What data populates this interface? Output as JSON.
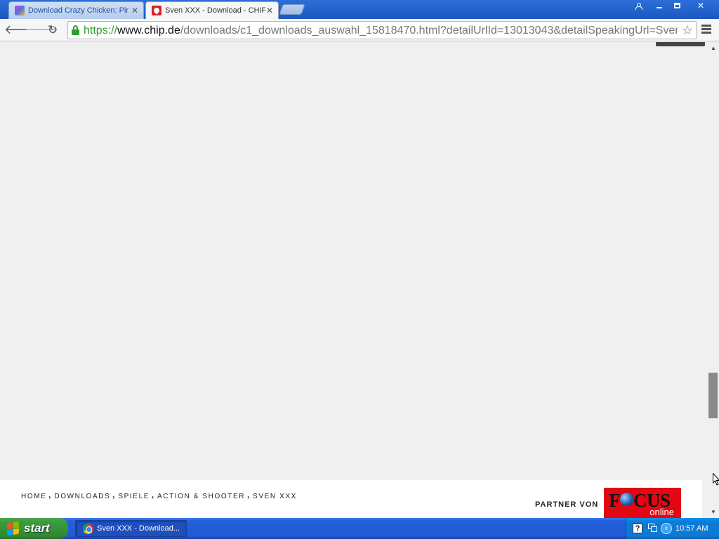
{
  "browser": {
    "tabs": [
      {
        "title": "Download Crazy Chicken: Pir",
        "active": false,
        "favicon": "crazy-chicken-favicon"
      },
      {
        "title": "Sven XXX - Download - CHIP",
        "active": true,
        "favicon": "chip-favicon"
      }
    ],
    "close_glyph": "✕",
    "url": {
      "scheme": "https://",
      "host": "www.chip.de",
      "path": "/downloads/c1_downloads_auswahl_15818470.html?detailUrlId=13013043&detailSpeakingUrl=Sven"
    },
    "icons": {
      "back": "arrow-left-icon",
      "forward": "arrow-right-icon",
      "reload": "reload-icon",
      "lock": "lock-icon",
      "bookmark": "star-icon",
      "menu": "hamburger-menu-icon"
    },
    "glyphs": {
      "back": "🡐",
      "forward": "🡒",
      "reload": "↻",
      "star": "☆"
    }
  },
  "page": {
    "breadcrumb": [
      "HOME",
      "DOWNLOADS",
      "SPIELE",
      "ACTION & SHOOTER",
      "SVEN XXX"
    ],
    "partner_label": "PARTNER VON",
    "partner_logo": {
      "word_left": "F",
      "word_right": "CUS",
      "sub": "online"
    },
    "colors": {
      "background": "#f0f0f0",
      "footer": "#ffffff",
      "focus_red": "#e30613"
    },
    "scroll_position": 0.78
  },
  "taskbar": {
    "start_label": "start",
    "task_item": "Sven XXX - Download...",
    "tray_help": "?",
    "tray_arrow": "‹",
    "clock": "10:57 AM"
  }
}
